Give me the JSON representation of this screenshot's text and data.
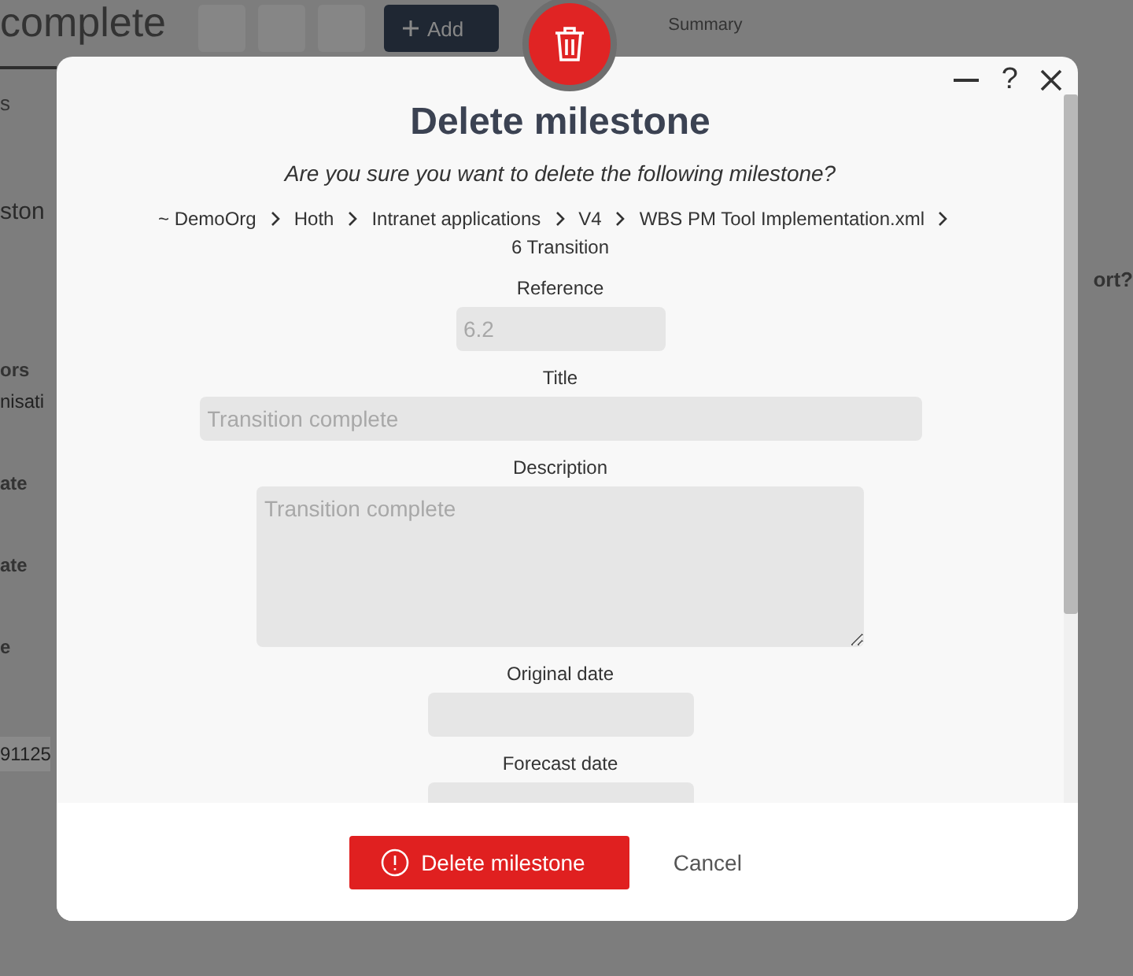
{
  "background": {
    "page_title": "complete",
    "add_button": "Add",
    "summary_menu": "Summary",
    "tab": "s",
    "section_title": "ston",
    "fields": [
      {
        "label": "ors",
        "value": "nisati"
      },
      {
        "label": "ate"
      },
      {
        "label": "ate"
      },
      {
        "label": "e"
      }
    ],
    "code": "91125",
    "side_question": "ort?"
  },
  "dialog": {
    "title": "Delete milestone",
    "question": "Are you sure you want to delete the following milestone?",
    "breadcrumb": [
      "~ DemoOrg",
      "Hoth",
      "Intranet applications",
      "V4",
      "WBS PM Tool Implementation.xml",
      "6 Transition"
    ],
    "fields": [
      {
        "kind": "input",
        "label": "Reference",
        "value": "6.2",
        "disabled": true
      },
      {
        "kind": "input",
        "label": "Title",
        "value": "Transition complete",
        "disabled": true
      },
      {
        "kind": "textarea",
        "label": "Description",
        "value": "Transition complete",
        "disabled": true
      },
      {
        "kind": "input",
        "label": "Original date",
        "disabled": true
      },
      {
        "kind": "input",
        "label": "Forecast date",
        "disabled": true
      }
    ],
    "confirm_button": "Delete milestone",
    "cancel_button": "Cancel",
    "help_button": "?"
  }
}
